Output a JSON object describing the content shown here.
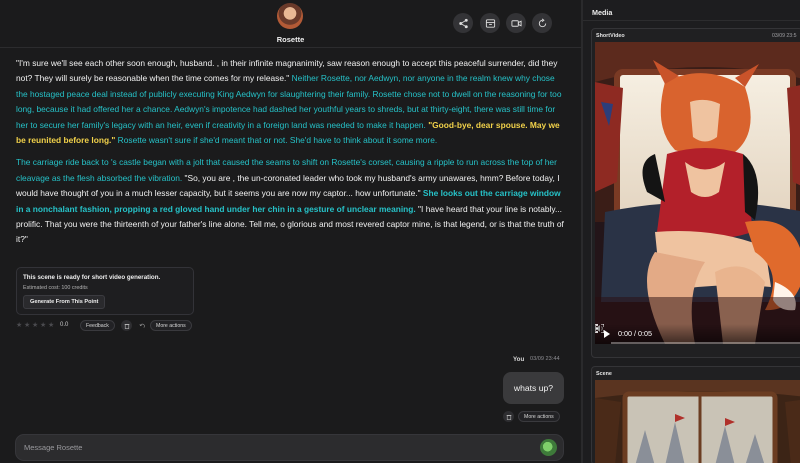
{
  "header": {
    "character_name": "Rosette",
    "buttons": [
      "share-icon",
      "archive-icon",
      "video-icon",
      "refresh-icon"
    ]
  },
  "story": {
    "p1": [
      {
        "style": "q",
        "text": "\"I'm sure we'll see each other soon enough, husband. , in their infinite magnanimity, saw reason enough to accept this peaceful surrender, did they not? They will surely be reasonable when the time comes for my release.\""
      },
      {
        "style": "n",
        "text": " Neither Rosette, nor Aedwyn, nor anyone in the realm knew why chose the hostaged peace deal instead of publicly executing King Aedwyn for slaughtering their family. Rosette chose not to dwell on the reasoning for too long, because it had offered her a chance. Aedwyn's impotence had dashed her youthful years to shreds, but at thirty-eight, there was still time for her to secure her family's legacy with an heir, even if creativity in a foreign land was needed to make it happen."
      },
      {
        "style": "y",
        "text": " \"Good-bye, dear spouse. May we be reunited before long.\""
      },
      {
        "style": "n",
        "text": " Rosette wasn't sure if she'd meant that or not. She'd have to think about it some more."
      }
    ],
    "p2": [
      {
        "style": "n",
        "text": "The carriage ride back to 's castle began with a jolt that caused the seams to shift on Rosette's corset, causing a ripple to run across the top of her cleavage as the flesh absorbed the vibration."
      },
      {
        "style": "q",
        "text": " \"So, you are , the un-coronated leader who took my husband's army unawares, hmm? Before today, I would have thought of you in a much lesser capacity, but it seems you are now my captor... how unfortunate.\""
      },
      {
        "style": "c",
        "text": " She looks out the carriage window in a nonchalant fashion, propping a red gloved hand under her chin in a gesture of unclear meaning."
      },
      {
        "style": "q",
        "text": " \"I have heard that your line is notably... prolific. That you were the thirteenth of your father's line alone. Tell me, o glorious and most revered captor mine, is that legend, or is that the truth of it?\""
      }
    ]
  },
  "video_prompt": {
    "title": "This scene is ready for short video generation.",
    "cost": "Estimated cost: 100 credits",
    "button": "Generate From This Point"
  },
  "message_actions": {
    "rating": "0.0",
    "stars_filled": 0,
    "stars_total": 5,
    "feedback": "Feedback",
    "more": "More actions"
  },
  "user_message": {
    "sender": "You",
    "time": "03/09 23:44",
    "text": "whats up?",
    "more": "More actions"
  },
  "composer": {
    "placeholder": "Message Rosette"
  },
  "media": {
    "title": "Media",
    "items": [
      {
        "label": "ShortVideo",
        "time": "03/09 23:5"
      },
      {
        "label": "Scene",
        "time": ""
      }
    ],
    "player": {
      "time": "0:00 / 0:05",
      "progress": 0
    }
  },
  "colors": {
    "dialogue": "#f2f2f2",
    "narration": "#26c2c8",
    "highlight": "#f2d24a",
    "background": "#1b1b1c"
  }
}
